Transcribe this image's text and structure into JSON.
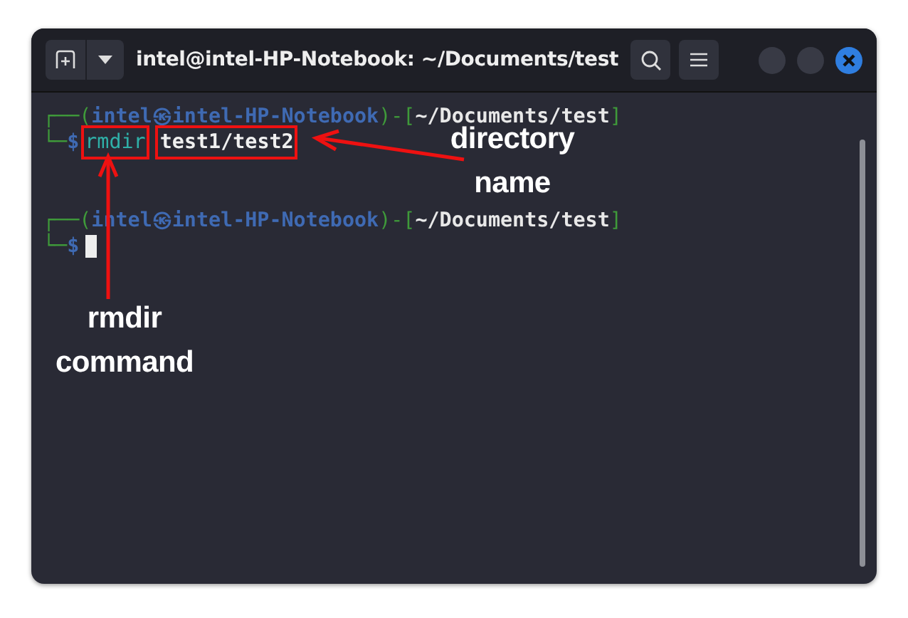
{
  "window": {
    "title": "intel@intel-HP-Notebook: ~/Documents/test"
  },
  "terminal": {
    "lines": [
      {
        "segments": [
          {
            "text": "┌──(",
            "kind": "frame"
          },
          {
            "text": "intel㉿intel-HP-Notebook",
            "kind": "user"
          },
          {
            "text": ")-[",
            "kind": "frame"
          },
          {
            "text": "~/Documents/test",
            "kind": "path"
          },
          {
            "text": "]",
            "kind": "frame"
          }
        ]
      },
      {
        "segments": [
          {
            "text": "└─",
            "kind": "frame"
          },
          {
            "text": "$",
            "kind": "prompt"
          },
          {
            "text": "rmdir",
            "kind": "command",
            "highlighted": true
          },
          {
            "text": "test1/test2",
            "kind": "arg",
            "highlighted": true
          }
        ]
      },
      {
        "kind": "blank"
      },
      {
        "kind": "blank"
      },
      {
        "segments": [
          {
            "text": "┌──(",
            "kind": "frame"
          },
          {
            "text": "intel㉿intel-HP-Notebook",
            "kind": "user"
          },
          {
            "text": ")-[",
            "kind": "frame"
          },
          {
            "text": "~/Documents/test",
            "kind": "path"
          },
          {
            "text": "]",
            "kind": "frame"
          }
        ]
      },
      {
        "segments": [
          {
            "text": "└─",
            "kind": "frame"
          },
          {
            "text": "$",
            "kind": "prompt"
          },
          {
            "kind": "cursor"
          }
        ]
      }
    ]
  },
  "annotations": [
    {
      "label": "directory name"
    },
    {
      "label": "rmdir command"
    }
  ]
}
